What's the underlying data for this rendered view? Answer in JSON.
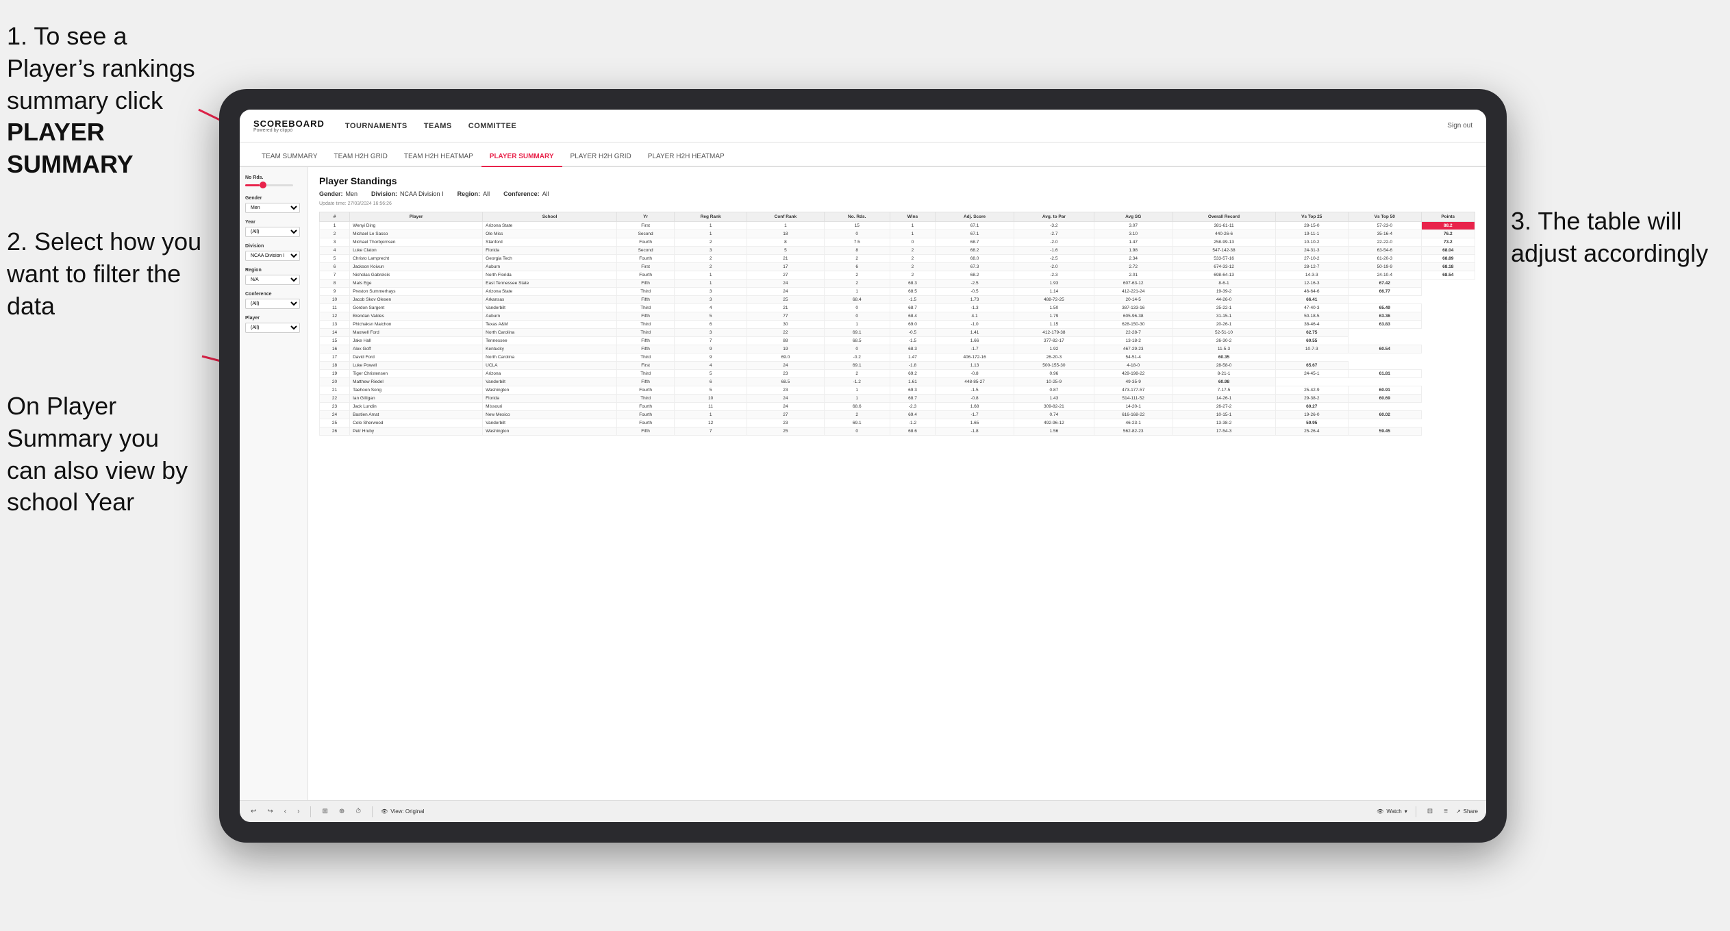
{
  "instructions": {
    "step1": {
      "number": "1.",
      "text": "To see a Player’s rankings summary click ",
      "bold": "PLAYER SUMMARY"
    },
    "step2": {
      "number": "2.",
      "text": "Select how you want to filter the data"
    },
    "step3": {
      "number": "3.",
      "text": "The table will adjust accordingly"
    },
    "step4_prefix": "On ",
    "step4_bold": "Player Summary",
    "step4_suffix": " you can also view by school ",
    "step4_year": "Year"
  },
  "app": {
    "logo_main": "SCOREBOARD",
    "logo_sub": "Powered by clippó"
  },
  "nav": {
    "items": [
      {
        "label": "TOURNAMENTS",
        "active": false
      },
      {
        "label": "TEAMS",
        "active": false
      },
      {
        "label": "COMMITTEE",
        "active": false
      }
    ],
    "sign_out": "Sign out"
  },
  "sub_nav": {
    "items": [
      {
        "label": "TEAM SUMMARY",
        "active": false
      },
      {
        "label": "TEAM H2H GRID",
        "active": false
      },
      {
        "label": "TEAM H2H HEATMAP",
        "active": false
      },
      {
        "label": "PLAYER SUMMARY",
        "active": true
      },
      {
        "label": "PLAYER H2H GRID",
        "active": false
      },
      {
        "label": "PLAYER H2H HEATMAP",
        "active": false
      }
    ]
  },
  "filters": {
    "no_rids_label": "No Rds.",
    "gender_label": "Gender",
    "gender_value": "Men",
    "year_label": "Year",
    "year_value": "(All)",
    "division_label": "Division",
    "division_value": "NCAA Division I",
    "region_label": "Region",
    "region_value": "N/A",
    "conference_label": "Conference",
    "conference_value": "(All)",
    "player_label": "Player",
    "player_value": "(All)"
  },
  "standings": {
    "title": "Player Standings",
    "update_time": "Update time:",
    "update_date": "27/03/2024 16:56:26",
    "gender_label": "Gender:",
    "gender_value": "Men",
    "division_label": "Division:",
    "division_value": "NCAA Division I",
    "region_label": "Region:",
    "region_value": "All",
    "conference_label": "Conference:",
    "conference_value": "All"
  },
  "table": {
    "headers": [
      "#",
      "Player",
      "School",
      "Yr",
      "Reg Rank",
      "Conf Rank",
      "No. Rds.",
      "Wins",
      "Adj. Score to Par",
      "Avg SG",
      "Overall Record",
      "Vs Top 25",
      "Vs Top 50",
      "Points"
    ],
    "rows": [
      [
        "1",
        "Wenyi Ding",
        "Arizona State",
        "First",
        "1",
        "1",
        "15",
        "1",
        "67.1",
        "-3.2",
        "3.07",
        "381-61-11",
        "28-15-0",
        "57-23-0",
        "88.2"
      ],
      [
        "2",
        "Michael Le Sasso",
        "Ole Miss",
        "Second",
        "1",
        "18",
        "0",
        "1",
        "67.1",
        "-2.7",
        "3.10",
        "440-26-6",
        "19-11-1",
        "35-16-4",
        "76.2"
      ],
      [
        "3",
        "Michael Thorbjornsen",
        "Stanford",
        "Fourth",
        "2",
        "8",
        "7.5",
        "0",
        "68.7",
        "-2.0",
        "1.47",
        "258-99-13",
        "10-10-2",
        "22-22-0",
        "73.2"
      ],
      [
        "4",
        "Luke Claton",
        "Florida",
        "Second",
        "3",
        "5",
        "8",
        "2",
        "68.2",
        "-1.6",
        "1.98",
        "547-142-38",
        "24-31-3",
        "63-54-6",
        "68.04"
      ],
      [
        "5",
        "Christo Lamprecht",
        "Georgia Tech",
        "Fourth",
        "2",
        "21",
        "2",
        "2",
        "68.0",
        "-2.5",
        "2.34",
        "533-57-16",
        "27-10-2",
        "61-20-3",
        "68.89"
      ],
      [
        "6",
        "Jackson Koivun",
        "Auburn",
        "First",
        "2",
        "17",
        "6",
        "2",
        "67.3",
        "-2.0",
        "2.72",
        "674-33-12",
        "28-12-7",
        "50-19-9",
        "68.18"
      ],
      [
        "7",
        "Nicholas Gabrelcik",
        "North Florida",
        "Fourth",
        "1",
        "27",
        "2",
        "2",
        "68.2",
        "-2.3",
        "2.01",
        "698-64-13",
        "14-3-3",
        "24-10-4",
        "68.54"
      ],
      [
        "8",
        "Mats Ege",
        "East Tennessee State",
        "Fifth",
        "1",
        "24",
        "2",
        "68.3",
        "-2.5",
        "1.93",
        "607-63-12",
        "8-6-1",
        "12-16-3",
        "67.42"
      ],
      [
        "9",
        "Preston Summerhays",
        "Arizona State",
        "Third",
        "3",
        "24",
        "1",
        "68.5",
        "-0.5",
        "1.14",
        "412-221-24",
        "19-39-2",
        "46-64-6",
        "66.77"
      ],
      [
        "10",
        "Jacob Skov Olesen",
        "Arkansas",
        "Fifth",
        "3",
        "25",
        "68.4",
        "-1.5",
        "1.73",
        "488-72-25",
        "20-14-5",
        "44-26-0",
        "66.41"
      ],
      [
        "11",
        "Gordon Sargent",
        "Vanderbilt",
        "Third",
        "4",
        "21",
        "0",
        "68.7",
        "-1.3",
        "1.50",
        "387-133-16",
        "25-22-1",
        "47-40-3",
        "65.49"
      ],
      [
        "12",
        "Brendan Valdes",
        "Auburn",
        "Fifth",
        "5",
        "77",
        "0",
        "68.4",
        "4.1",
        "1.79",
        "605-96-38",
        "31-15-1",
        "50-18-5",
        "63.36"
      ],
      [
        "13",
        "Phichaksn Maichon",
        "Texas A&M",
        "Third",
        "6",
        "30",
        "1",
        "69.0",
        "-1.0",
        "1.15",
        "628-150-30",
        "20-26-1",
        "38-46-4",
        "63.83"
      ],
      [
        "14",
        "Maxwell Ford",
        "North Carolina",
        "Third",
        "3",
        "22",
        "69.1",
        "-0.5",
        "1.41",
        "412-179-38",
        "22-28-7",
        "52-51-10",
        "62.75"
      ],
      [
        "15",
        "Jake Hall",
        "Tennessee",
        "Fifth",
        "7",
        "88",
        "68.5",
        "-1.5",
        "1.66",
        "377-82-17",
        "13-18-2",
        "26-30-2",
        "60.55"
      ],
      [
        "16",
        "Alex Goff",
        "Kentucky",
        "Fifth",
        "9",
        "19",
        "0",
        "68.3",
        "-1.7",
        "1.92",
        "467-29-23",
        "11-5-3",
        "10-7-3",
        "60.54"
      ],
      [
        "17",
        "David Ford",
        "North Carolina",
        "Third",
        "9",
        "69.0",
        "-0.2",
        "1.47",
        "406-172-16",
        "26-20-3",
        "54-51-4",
        "60.35"
      ],
      [
        "18",
        "Luke Powell",
        "UCLA",
        "First",
        "4",
        "24",
        "69.1",
        "-1.8",
        "1.13",
        "500-155-30",
        "4-18-0",
        "28-58-0",
        "65.67"
      ],
      [
        "19",
        "Tiger Christensen",
        "Arizona",
        "Third",
        "5",
        "23",
        "2",
        "69.2",
        "-0.8",
        "0.96",
        "429-198-22",
        "8-21-1",
        "24-45-1",
        "61.81"
      ],
      [
        "20",
        "Matthew Riedel",
        "Vanderbilt",
        "Fifth",
        "6",
        "68.5",
        "-1.2",
        "1.61",
        "448-85-27",
        "10-25-9",
        "49-35-9",
        "60.98"
      ],
      [
        "21",
        "Taehoon Song",
        "Washington",
        "Fourth",
        "5",
        "23",
        "1",
        "69.3",
        "-1.5",
        "0.87",
        "473-177-57",
        "7-17-5",
        "25-42-9",
        "60.91"
      ],
      [
        "22",
        "Ian Gilligan",
        "Florida",
        "Third",
        "10",
        "24",
        "1",
        "68.7",
        "-0.8",
        "1.43",
        "514-111-52",
        "14-26-1",
        "29-38-2",
        "60.69"
      ],
      [
        "23",
        "Jack Lundin",
        "Missouri",
        "Fourth",
        "11",
        "24",
        "68.6",
        "-2.3",
        "1.68",
        "309-82-21",
        "14-20-1",
        "26-27-2",
        "60.27"
      ],
      [
        "24",
        "Bastien Amat",
        "New Mexico",
        "Fourth",
        "1",
        "27",
        "2",
        "69.4",
        "-1.7",
        "0.74",
        "616-168-22",
        "10-15-1",
        "19-26-0",
        "60.02"
      ],
      [
        "25",
        "Cole Sherwood",
        "Vanderbilt",
        "Fourth",
        "12",
        "23",
        "69.1",
        "-1.2",
        "1.65",
        "492-96-12",
        "46-23-1",
        "13-38-2",
        "59.95"
      ],
      [
        "26",
        "Petr Hruby",
        "Washington",
        "Fifth",
        "7",
        "25",
        "0",
        "68.6",
        "-1.8",
        "1.56",
        "562-82-23",
        "17-54-3",
        "25-26-4",
        "59.45"
      ]
    ]
  },
  "toolbar": {
    "view_label": "View: Original",
    "watch_label": "Watch",
    "share_label": "Share"
  }
}
